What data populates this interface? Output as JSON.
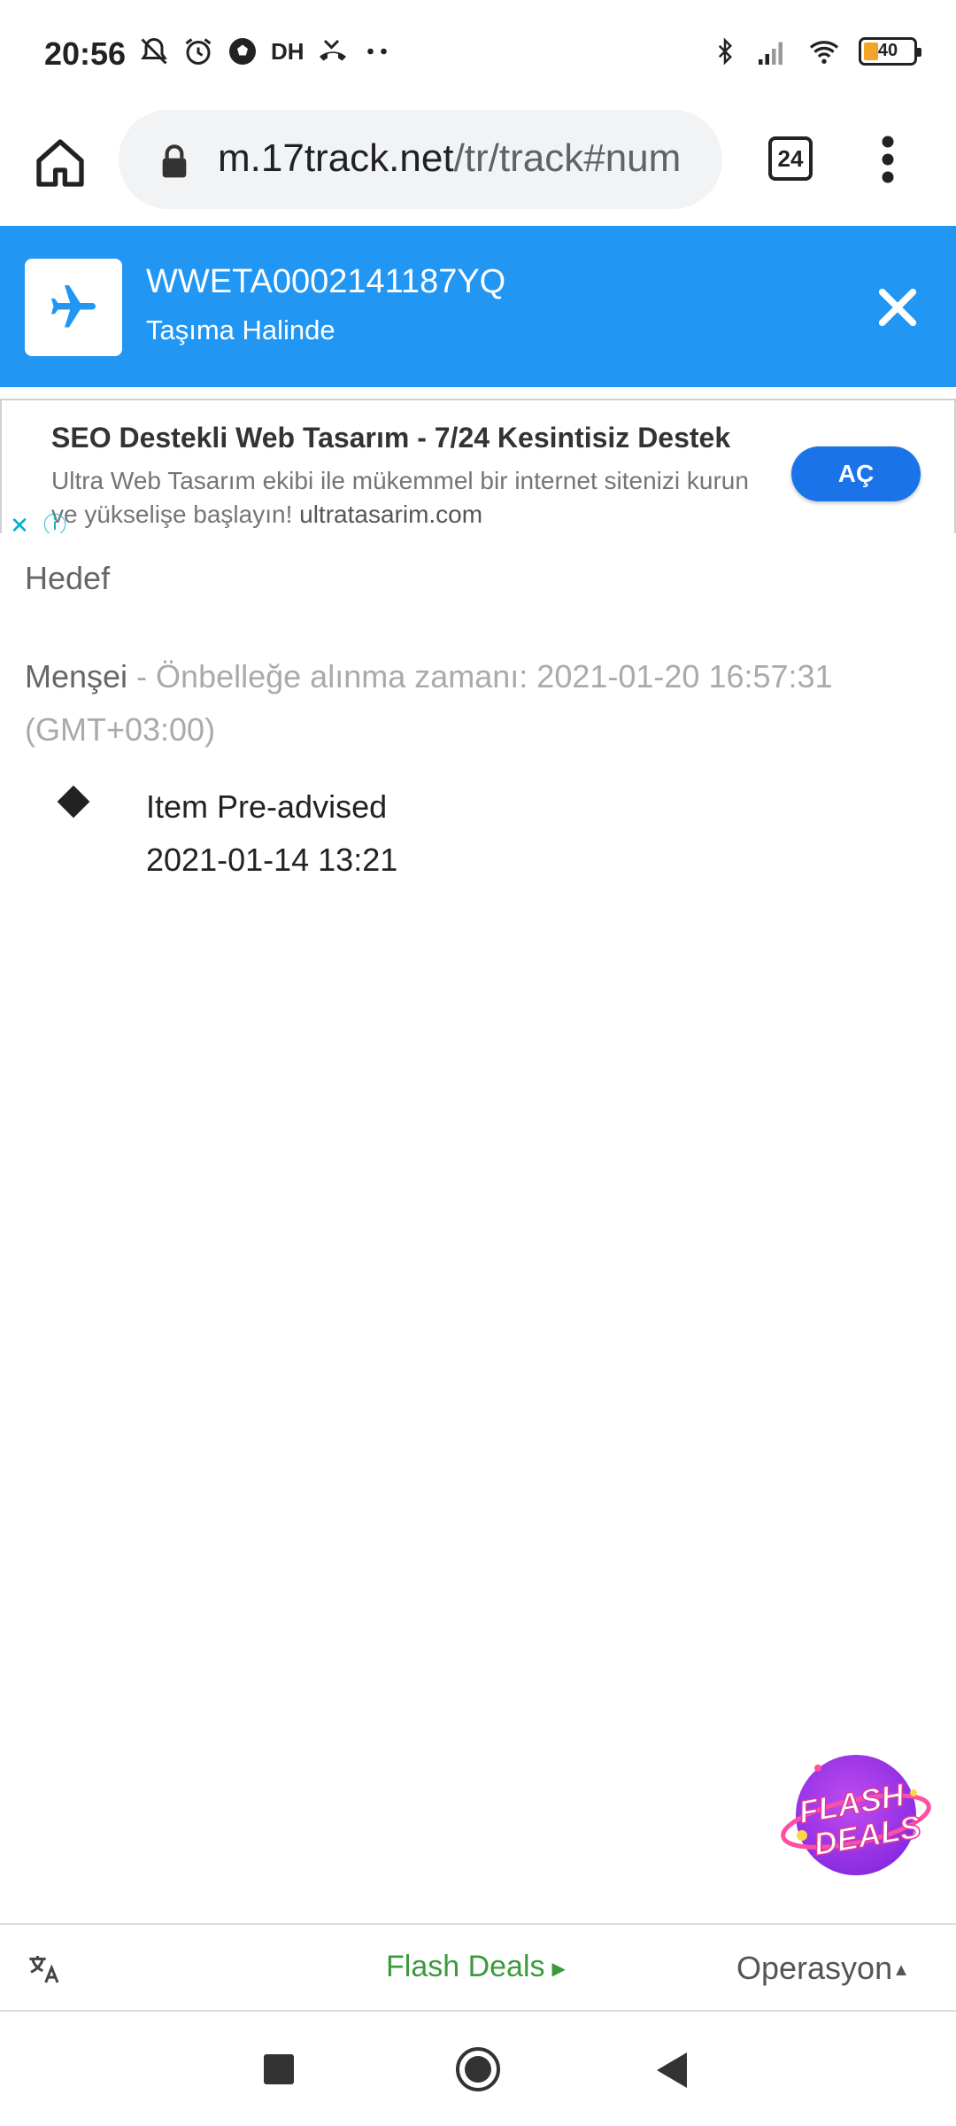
{
  "status_bar": {
    "time": "20:56",
    "carrier_tag": "DH",
    "battery": "40",
    "icons": [
      "muted-bell-icon",
      "alarm-icon",
      "football-icon",
      "missed-call-icon",
      "more-dots-icon",
      "bluetooth-icon",
      "signal-icon",
      "wifi-icon",
      "battery-icon"
    ]
  },
  "browser": {
    "url_host": "m.17track.net",
    "url_path": "/tr/track#num",
    "tab_count": "24"
  },
  "shipment": {
    "tracking_number": "WWETA0002141187YQ",
    "status": "Taşıma Halinde",
    "accent_color": "#2196f3"
  },
  "ad": {
    "title": "SEO Destekli Web Tasarım - 7/24 Kesintisiz Destek",
    "description": "Ultra Web Tasarım ekibi ile mükemmel bir internet sitenizi kurun ve yükselişe başlayın!",
    "domain": "ultratasarim.com",
    "button_label": "AÇ"
  },
  "tracking": {
    "destination_label": "Hedef",
    "origin_label": "Menşei",
    "cache_text": " - Önbelleğe alınma zamanı: 2021-01-20 16:57:31 (GMT+03:00)",
    "events": [
      {
        "title": "Item Pre-advised",
        "time": "2021-01-14 13:21"
      }
    ]
  },
  "bottom_bar": {
    "flash_deals_label": "Flash Deals",
    "operations_label": "Operasyon",
    "flash_badge_line1": "FLASH",
    "flash_badge_line2": "DEALS"
  }
}
